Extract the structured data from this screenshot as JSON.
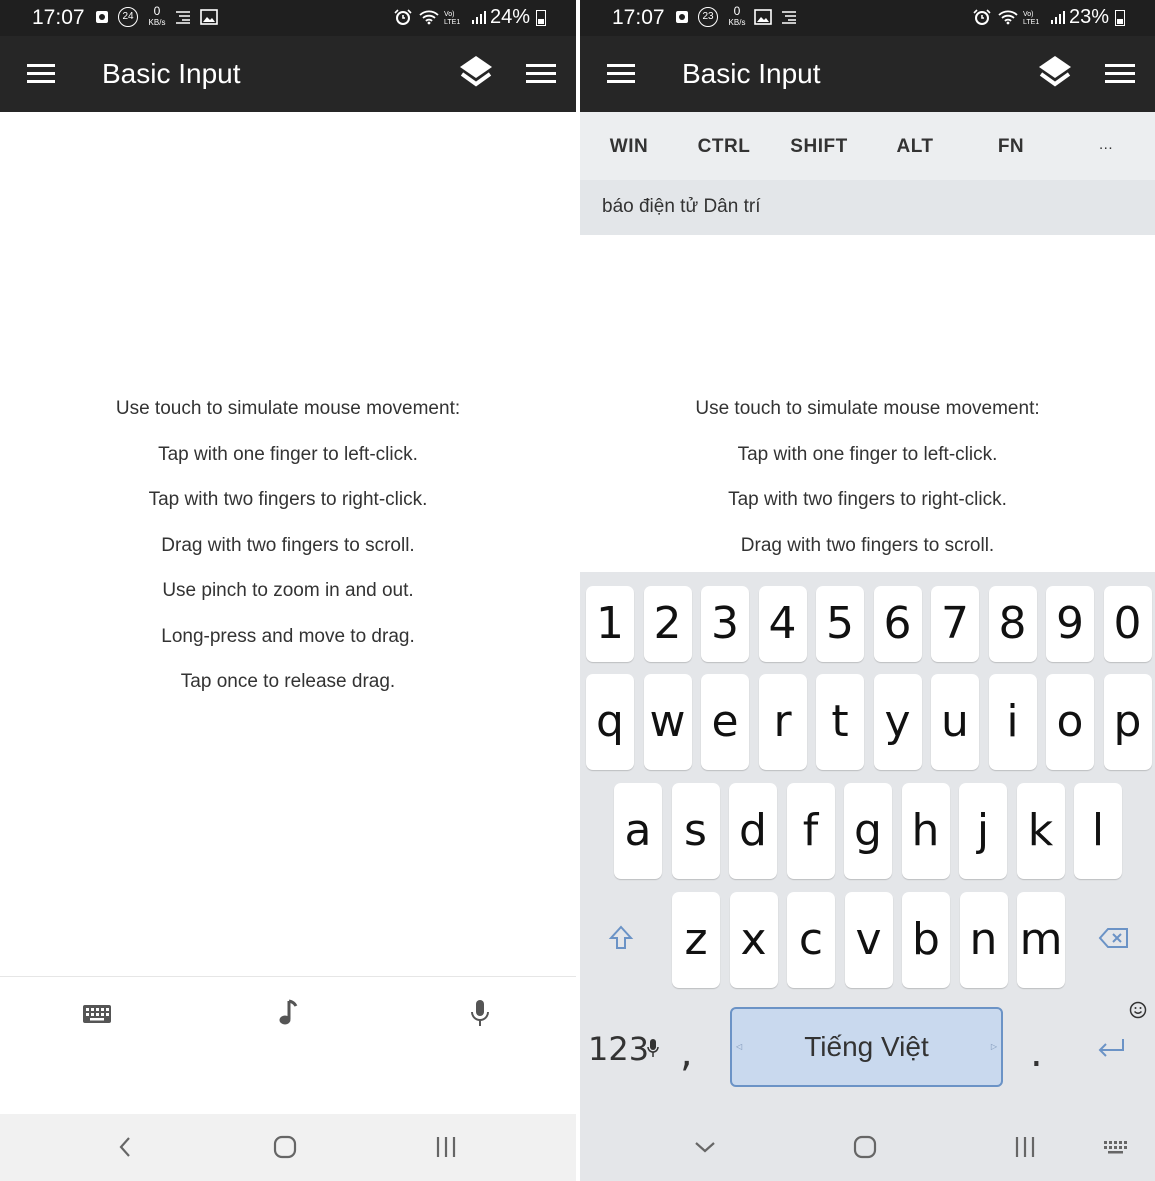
{
  "left": {
    "status": {
      "time": "17:07",
      "net_speed": "0",
      "net_unit": "KB/s",
      "notif_count": "24",
      "battery": "24%"
    },
    "app_title": "Basic Input",
    "instructions": [
      "Use touch to simulate mouse movement:",
      "Tap with one finger to left-click.",
      "Tap with two fingers to right-click.",
      "Drag with two fingers to scroll.",
      "Use pinch to zoom in and out.",
      "Long-press and move to drag.",
      "Tap once to release drag."
    ],
    "toolbar": {
      "icons": [
        "keyboard-icon",
        "music-note-icon",
        "microphone-icon"
      ]
    },
    "nav": {
      "icons": [
        "back-icon",
        "home-icon",
        "recents-icon"
      ]
    }
  },
  "right": {
    "status": {
      "time": "17:07",
      "net_speed": "0",
      "net_unit": "KB/s",
      "notif_count": "23",
      "battery": "23%"
    },
    "app_title": "Basic Input",
    "modifiers": [
      "WIN",
      "CTRL",
      "SHIFT",
      "ALT",
      "FN",
      "..."
    ],
    "text_input": "báo điện tử Dân trí",
    "instructions": [
      "Use touch to simulate mouse movement:",
      "Tap with one finger to left-click.",
      "Tap with two fingers to right-click.",
      "Drag with two fingers to scroll."
    ],
    "keyboard": {
      "row_numbers": [
        "1",
        "2",
        "3",
        "4",
        "5",
        "6",
        "7",
        "8",
        "9",
        "0"
      ],
      "row1": [
        "q",
        "w",
        "e",
        "r",
        "t",
        "y",
        "u",
        "i",
        "o",
        "p"
      ],
      "row2": [
        "a",
        "s",
        "d",
        "f",
        "g",
        "h",
        "j",
        "k",
        "l"
      ],
      "row3": [
        "z",
        "x",
        "c",
        "v",
        "b",
        "n",
        "m"
      ],
      "numbers_key": "123",
      "comma_key": ",",
      "space_label": "Tiếng Việt",
      "period_key": ".",
      "accent_color": "#6b93c6"
    },
    "nav": {
      "icons": [
        "hide-keyboard-icon",
        "home-icon",
        "recents-icon",
        "keyboard-switch-icon"
      ]
    }
  }
}
